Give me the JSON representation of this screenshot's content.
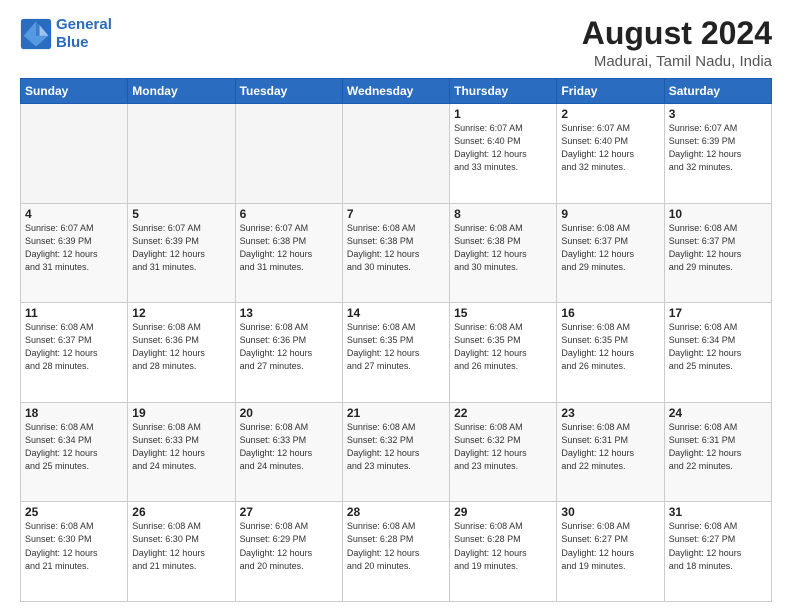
{
  "logo": {
    "line1": "General",
    "line2": "Blue"
  },
  "title": "August 2024",
  "subtitle": "Madurai, Tamil Nadu, India",
  "days_of_week": [
    "Sunday",
    "Monday",
    "Tuesday",
    "Wednesday",
    "Thursday",
    "Friday",
    "Saturday"
  ],
  "weeks": [
    [
      {
        "day": "",
        "info": ""
      },
      {
        "day": "",
        "info": ""
      },
      {
        "day": "",
        "info": ""
      },
      {
        "day": "",
        "info": ""
      },
      {
        "day": "1",
        "info": "Sunrise: 6:07 AM\nSunset: 6:40 PM\nDaylight: 12 hours\nand 33 minutes."
      },
      {
        "day": "2",
        "info": "Sunrise: 6:07 AM\nSunset: 6:40 PM\nDaylight: 12 hours\nand 32 minutes."
      },
      {
        "day": "3",
        "info": "Sunrise: 6:07 AM\nSunset: 6:39 PM\nDaylight: 12 hours\nand 32 minutes."
      }
    ],
    [
      {
        "day": "4",
        "info": "Sunrise: 6:07 AM\nSunset: 6:39 PM\nDaylight: 12 hours\nand 31 minutes."
      },
      {
        "day": "5",
        "info": "Sunrise: 6:07 AM\nSunset: 6:39 PM\nDaylight: 12 hours\nand 31 minutes."
      },
      {
        "day": "6",
        "info": "Sunrise: 6:07 AM\nSunset: 6:38 PM\nDaylight: 12 hours\nand 31 minutes."
      },
      {
        "day": "7",
        "info": "Sunrise: 6:08 AM\nSunset: 6:38 PM\nDaylight: 12 hours\nand 30 minutes."
      },
      {
        "day": "8",
        "info": "Sunrise: 6:08 AM\nSunset: 6:38 PM\nDaylight: 12 hours\nand 30 minutes."
      },
      {
        "day": "9",
        "info": "Sunrise: 6:08 AM\nSunset: 6:37 PM\nDaylight: 12 hours\nand 29 minutes."
      },
      {
        "day": "10",
        "info": "Sunrise: 6:08 AM\nSunset: 6:37 PM\nDaylight: 12 hours\nand 29 minutes."
      }
    ],
    [
      {
        "day": "11",
        "info": "Sunrise: 6:08 AM\nSunset: 6:37 PM\nDaylight: 12 hours\nand 28 minutes."
      },
      {
        "day": "12",
        "info": "Sunrise: 6:08 AM\nSunset: 6:36 PM\nDaylight: 12 hours\nand 28 minutes."
      },
      {
        "day": "13",
        "info": "Sunrise: 6:08 AM\nSunset: 6:36 PM\nDaylight: 12 hours\nand 27 minutes."
      },
      {
        "day": "14",
        "info": "Sunrise: 6:08 AM\nSunset: 6:35 PM\nDaylight: 12 hours\nand 27 minutes."
      },
      {
        "day": "15",
        "info": "Sunrise: 6:08 AM\nSunset: 6:35 PM\nDaylight: 12 hours\nand 26 minutes."
      },
      {
        "day": "16",
        "info": "Sunrise: 6:08 AM\nSunset: 6:35 PM\nDaylight: 12 hours\nand 26 minutes."
      },
      {
        "day": "17",
        "info": "Sunrise: 6:08 AM\nSunset: 6:34 PM\nDaylight: 12 hours\nand 25 minutes."
      }
    ],
    [
      {
        "day": "18",
        "info": "Sunrise: 6:08 AM\nSunset: 6:34 PM\nDaylight: 12 hours\nand 25 minutes."
      },
      {
        "day": "19",
        "info": "Sunrise: 6:08 AM\nSunset: 6:33 PM\nDaylight: 12 hours\nand 24 minutes."
      },
      {
        "day": "20",
        "info": "Sunrise: 6:08 AM\nSunset: 6:33 PM\nDaylight: 12 hours\nand 24 minutes."
      },
      {
        "day": "21",
        "info": "Sunrise: 6:08 AM\nSunset: 6:32 PM\nDaylight: 12 hours\nand 23 minutes."
      },
      {
        "day": "22",
        "info": "Sunrise: 6:08 AM\nSunset: 6:32 PM\nDaylight: 12 hours\nand 23 minutes."
      },
      {
        "day": "23",
        "info": "Sunrise: 6:08 AM\nSunset: 6:31 PM\nDaylight: 12 hours\nand 22 minutes."
      },
      {
        "day": "24",
        "info": "Sunrise: 6:08 AM\nSunset: 6:31 PM\nDaylight: 12 hours\nand 22 minutes."
      }
    ],
    [
      {
        "day": "25",
        "info": "Sunrise: 6:08 AM\nSunset: 6:30 PM\nDaylight: 12 hours\nand 21 minutes."
      },
      {
        "day": "26",
        "info": "Sunrise: 6:08 AM\nSunset: 6:30 PM\nDaylight: 12 hours\nand 21 minutes."
      },
      {
        "day": "27",
        "info": "Sunrise: 6:08 AM\nSunset: 6:29 PM\nDaylight: 12 hours\nand 20 minutes."
      },
      {
        "day": "28",
        "info": "Sunrise: 6:08 AM\nSunset: 6:28 PM\nDaylight: 12 hours\nand 20 minutes."
      },
      {
        "day": "29",
        "info": "Sunrise: 6:08 AM\nSunset: 6:28 PM\nDaylight: 12 hours\nand 19 minutes."
      },
      {
        "day": "30",
        "info": "Sunrise: 6:08 AM\nSunset: 6:27 PM\nDaylight: 12 hours\nand 19 minutes."
      },
      {
        "day": "31",
        "info": "Sunrise: 6:08 AM\nSunset: 6:27 PM\nDaylight: 12 hours\nand 18 minutes."
      }
    ]
  ]
}
